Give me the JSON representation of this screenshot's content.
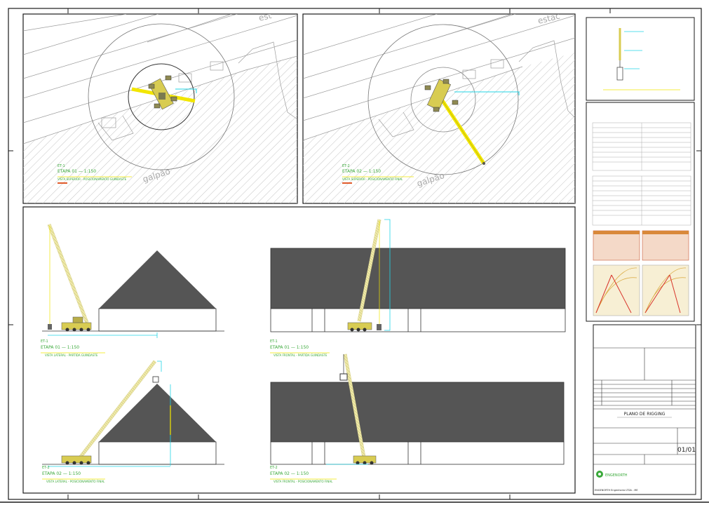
{
  "drawing": {
    "title_block": {
      "title": "PLANO DE RIGGING",
      "sheet_number": "01/01",
      "company_logo_text": "ENGENORTH",
      "company_footer": "ENGENORTH Engenharia LTDA - ME"
    },
    "colors": {
      "frame": "#1a1a1a",
      "crane_yellow": "#f2e600",
      "crane_body": "#d8cc52",
      "boom": "#eee9a6",
      "dimension_cyan": "#22d4e6",
      "roof_dark": "#555555",
      "hatch": "#bdbdbd",
      "label_green": "#3aa93a"
    }
  }
}
